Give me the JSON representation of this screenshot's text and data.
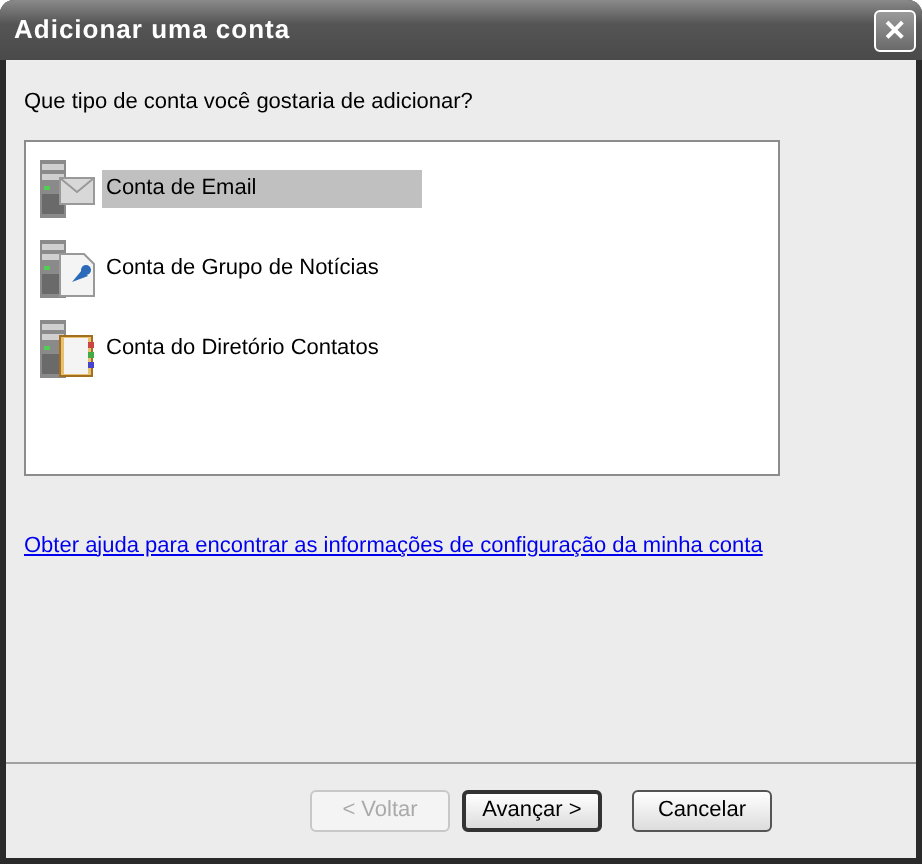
{
  "window": {
    "title": "Adicionar uma conta",
    "close": "✕"
  },
  "prompt": "Que tipo de conta você gostaria de adicionar?",
  "account_types": [
    {
      "kind": "email",
      "label": "Conta de Email",
      "selected": true
    },
    {
      "kind": "news",
      "label": "Conta de Grupo de Notícias",
      "selected": false
    },
    {
      "kind": "directory",
      "label": "Conta do Diretório Contatos",
      "selected": false
    }
  ],
  "help_link": "Obter ajuda para encontrar as informações de configuração da minha conta",
  "buttons": [
    {
      "label": "< Voltar",
      "disabled": true,
      "default": false
    },
    {
      "label": "Avançar >",
      "disabled": false,
      "default": true
    },
    {
      "label": "Cancelar",
      "disabled": false,
      "default": false
    }
  ]
}
